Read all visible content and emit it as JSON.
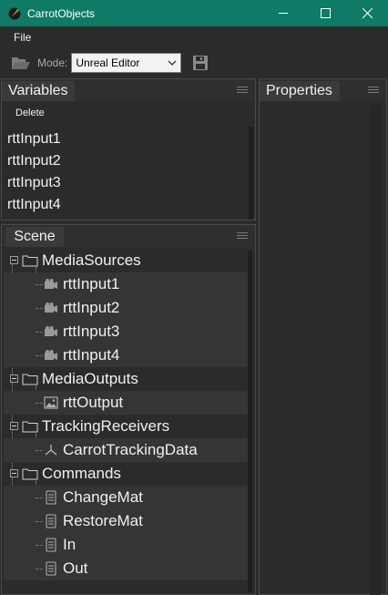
{
  "window": {
    "title": "CarrotObjects"
  },
  "menu": {
    "file": "File"
  },
  "toolbar": {
    "mode_label": "Mode:",
    "mode_value": "Unreal Editor"
  },
  "variables": {
    "tab": "Variables",
    "delete_label": "Delete",
    "items": [
      "rttInput1",
      "rttInput2",
      "rttInput3",
      "rttInput4"
    ]
  },
  "properties": {
    "tab": "Properties"
  },
  "scene": {
    "tab": "Scene",
    "groups": [
      {
        "label": "MediaSources",
        "children": [
          "rttInput1",
          "rttInput2",
          "rttInput3",
          "rttInput4"
        ]
      },
      {
        "label": "MediaOutputs",
        "children": [
          "rttOutput"
        ]
      },
      {
        "label": "TrackingReceivers",
        "children": [
          "CarrotTrackingData"
        ]
      },
      {
        "label": "Commands",
        "children": [
          "ChangeMat",
          "RestoreMat",
          "In",
          "Out"
        ]
      }
    ]
  },
  "colors": {
    "titlebar": "#0f7b66",
    "background": "#2b2b2b",
    "text": "#f0f0f0"
  }
}
